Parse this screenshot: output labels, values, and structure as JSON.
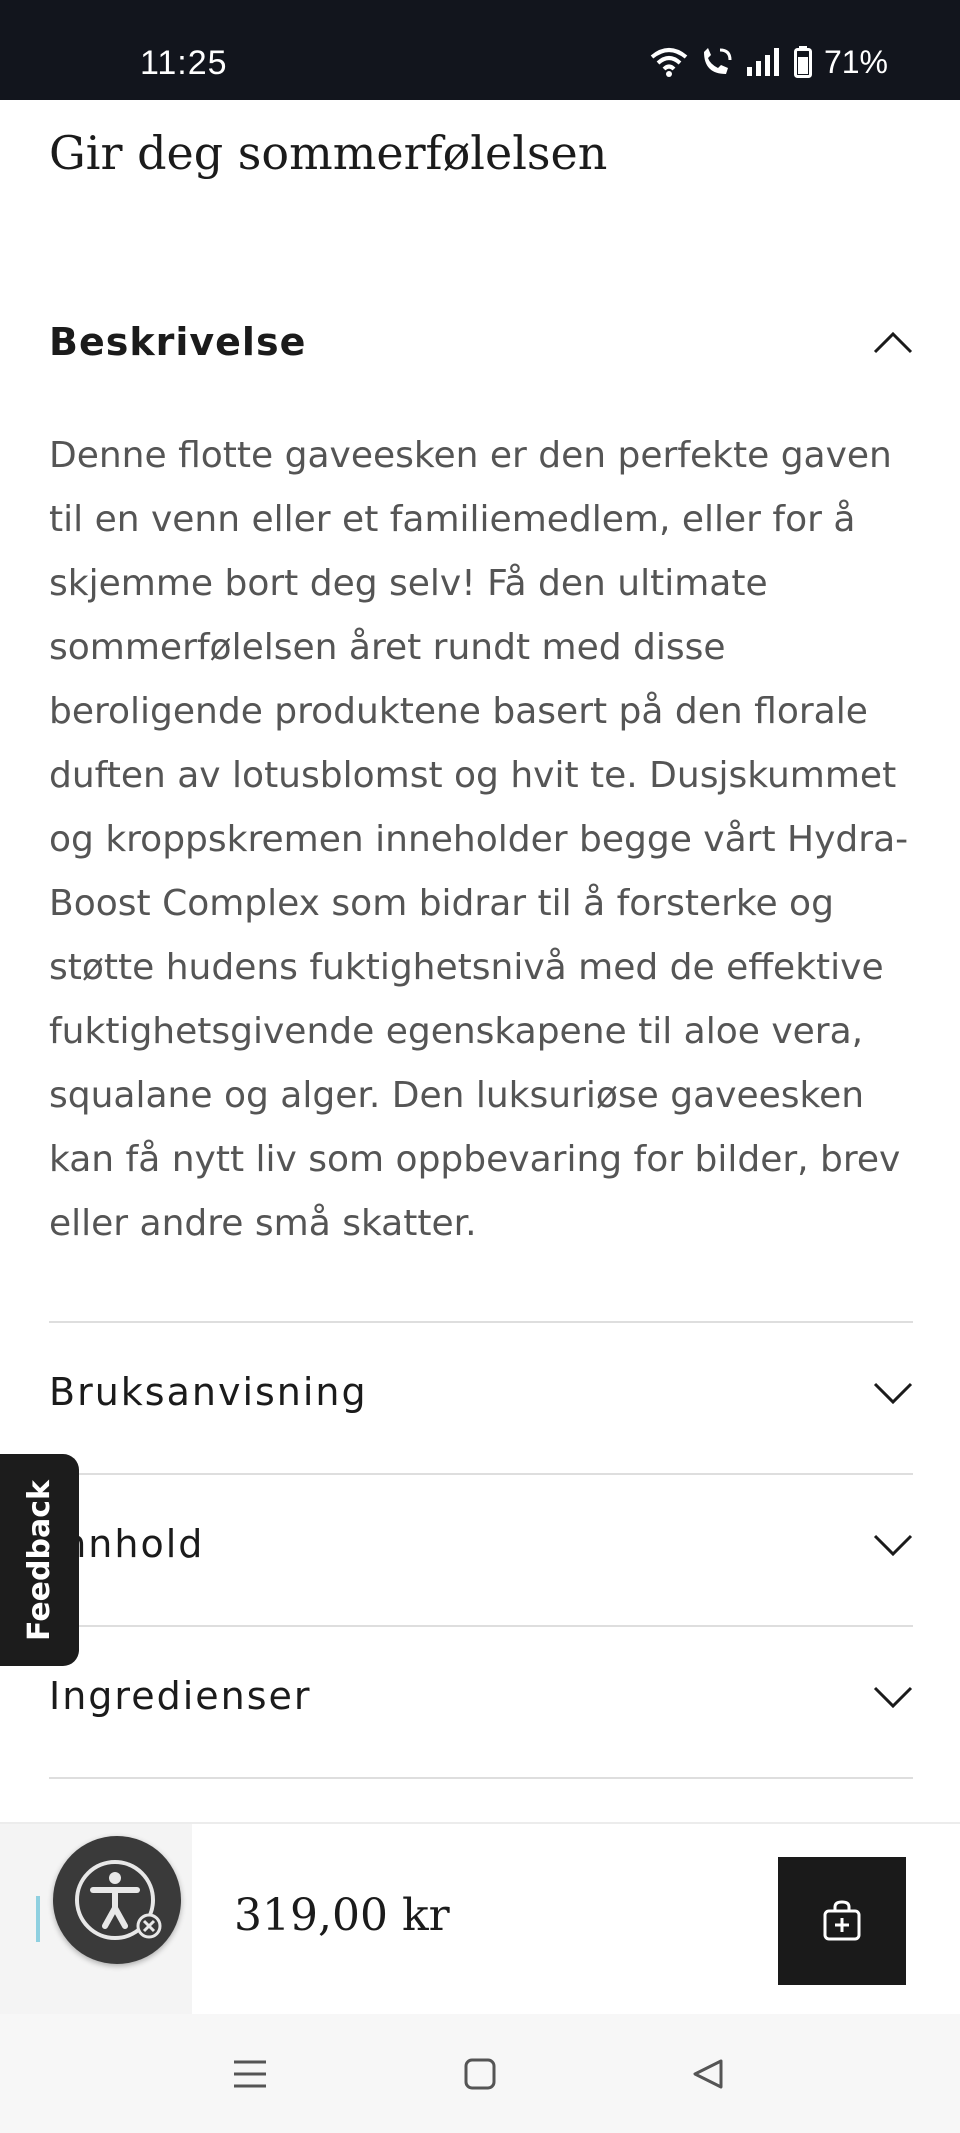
{
  "status_bar": {
    "time": "11:25",
    "battery": "71%",
    "icons": [
      "wifi-icon",
      "wifi-call-icon",
      "signal-icon",
      "battery-icon"
    ]
  },
  "product": {
    "tagline": "Gir deg sommerfølelsen",
    "price": "319,00 kr"
  },
  "description": {
    "title": "Beskrivelse",
    "expanded": true,
    "body": "Denne flotte gaveesken er den perfekte gaven til en venn eller et familiemedlem, eller for å skjemme bort deg selv! Få den ultimate sommerfølelsen året rundt med disse beroligende produktene basert på den florale duften av lotusblomst og hvit te. Dusjskummet og kroppskremen inneholder begge vårt Hydra-Boost Complex som bidrar til å forsterke og støtte hudens fuktighetsnivå med de effektive fuktighetsgivende egenskapene til aloe vera, squalane og alger. Den luksuriøse gaveesken kan få nytt liv som oppbevaring for bilder, brev eller andre små skatter."
  },
  "accordion": [
    {
      "label": "Bruksanvisning",
      "expanded": false
    },
    {
      "label": "Innhold",
      "expanded": false
    },
    {
      "label": "Ingredienser",
      "expanded": false
    }
  ],
  "feedback": {
    "label": "Feedback"
  },
  "colors": {
    "statusbar": "#12151d",
    "cart_button": "#1a1a1a",
    "text": "#1b1b1b",
    "body_text": "#555555"
  }
}
